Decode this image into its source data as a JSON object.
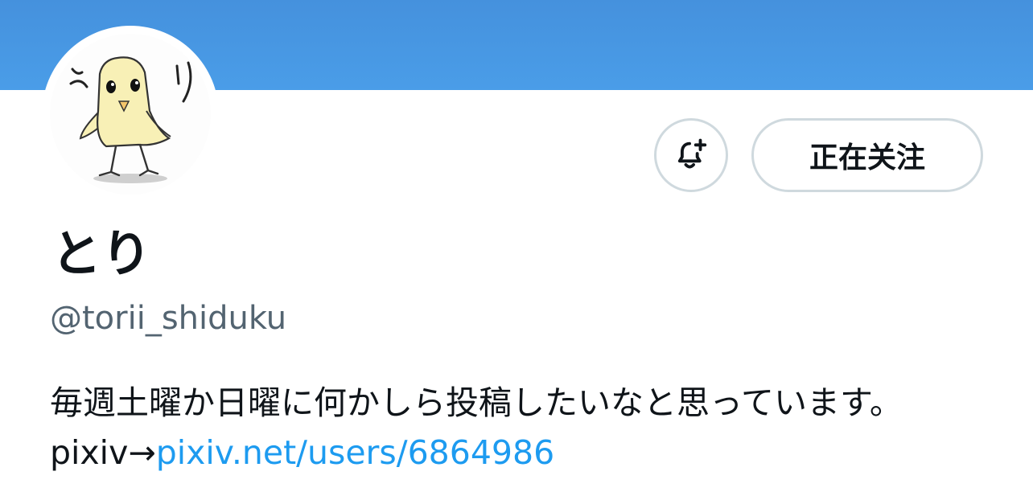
{
  "profile": {
    "display_name": "とり",
    "handle": "@torii_shiduku",
    "bio_text": "毎週土曜か日曜に何かしら投稿したいなと思っています。pixiv→",
    "bio_link": "pixiv.net/users/6864986",
    "avatar_icon": "chick-drawing-avatar"
  },
  "actions": {
    "notify_icon": "bell-plus-icon",
    "follow_label": "正在关注"
  },
  "colors": {
    "banner": "#4a9ae6",
    "link": "#1d9bf0",
    "text": "#0f1419",
    "secondary_text": "#536471",
    "button_border": "#cfd9de"
  }
}
